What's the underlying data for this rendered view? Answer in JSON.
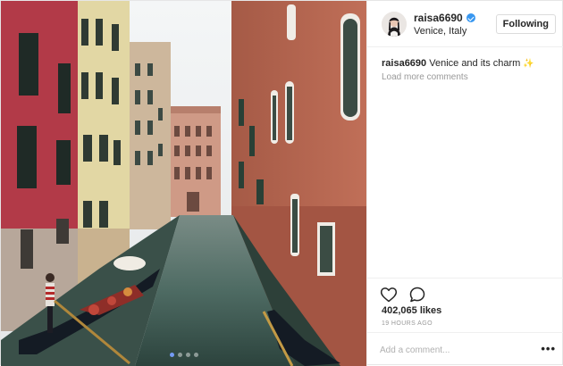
{
  "post": {
    "photo_alt": "Venice canal",
    "carousel": {
      "count": 4,
      "active_index": 0
    }
  },
  "header": {
    "username": "raisa6690",
    "verified": true,
    "location": "Venice, Italy",
    "follow_label": "Following"
  },
  "caption": {
    "username": "raisa6690",
    "text": "Venice and its charm",
    "emoji": "✨"
  },
  "comments": {
    "load_more_label": "Load more comments"
  },
  "actions": {
    "like_icon": "heart-icon",
    "comment_icon": "comment-icon"
  },
  "stats": {
    "likes": "402,065 likes",
    "time_ago": "19 HOURS AGO"
  },
  "comment_box": {
    "placeholder": "Add a comment...",
    "more_label": "•••"
  },
  "colors": {
    "verified": "#3897f0",
    "muted_text": "#999999",
    "border": "#efefef"
  }
}
